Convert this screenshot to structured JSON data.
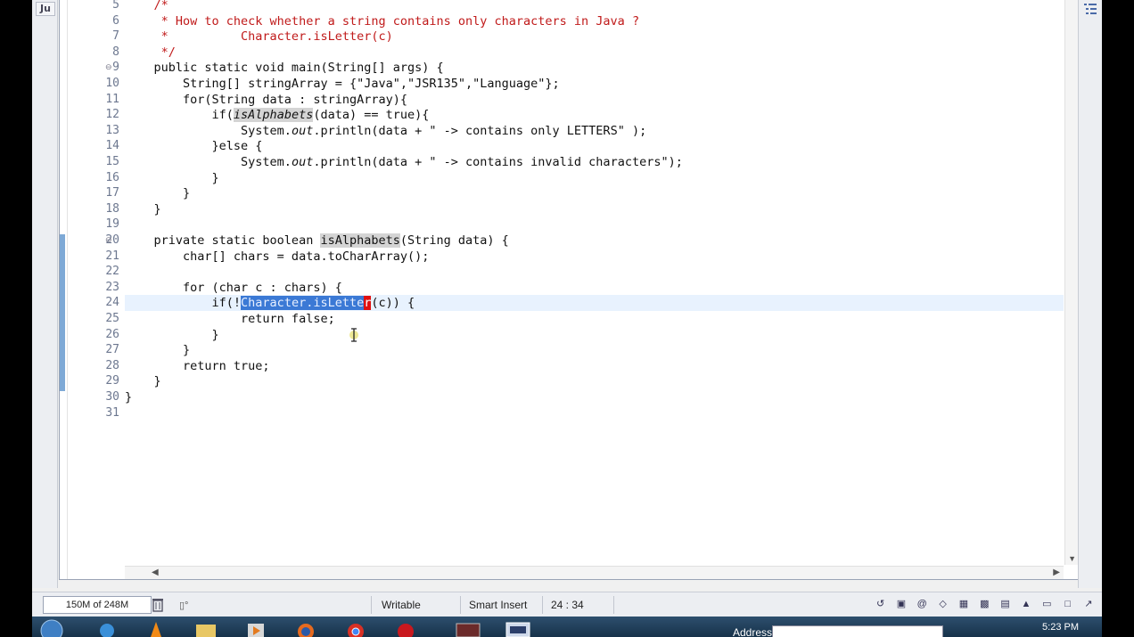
{
  "left_tab": {
    "label": "Ju"
  },
  "code_lines": [
    {
      "num": "5",
      "fold": "",
      "current": false,
      "tokens": [
        {
          "t": "    /*",
          "c": "com"
        }
      ]
    },
    {
      "num": "6",
      "fold": "",
      "current": false,
      "tokens": [
        {
          "t": "     * How to check whether a string contains only characters in Java ?",
          "c": "com"
        }
      ]
    },
    {
      "num": "7",
      "fold": "",
      "current": false,
      "tokens": [
        {
          "t": "     *          Character.isLetter(c)",
          "c": "com"
        }
      ]
    },
    {
      "num": "8",
      "fold": "",
      "current": false,
      "tokens": [
        {
          "t": "     */",
          "c": "com"
        }
      ]
    },
    {
      "num": "9",
      "fold": "⊖",
      "current": false,
      "tokens": [
        {
          "t": "    public static void main(String[] args) {",
          "c": ""
        }
      ]
    },
    {
      "num": "10",
      "fold": "",
      "current": false,
      "tokens": [
        {
          "t": "        String[] stringArray = {\"Java\",\"JSR135\",\"Language\"};",
          "c": ""
        }
      ]
    },
    {
      "num": "11",
      "fold": "",
      "current": false,
      "tokens": [
        {
          "t": "        for(String data : stringArray){",
          "c": ""
        }
      ]
    },
    {
      "num": "12",
      "fold": "",
      "current": false,
      "tokens": [
        {
          "t": "            if(",
          "c": ""
        },
        {
          "t": "isAlphabets",
          "c": "it occ"
        },
        {
          "t": "(data) == true){",
          "c": ""
        }
      ]
    },
    {
      "num": "13",
      "fold": "",
      "current": false,
      "tokens": [
        {
          "t": "                System.",
          "c": ""
        },
        {
          "t": "out",
          "c": "it"
        },
        {
          "t": ".println(data + \" -> contains only LETTERS\" );",
          "c": ""
        }
      ]
    },
    {
      "num": "14",
      "fold": "",
      "current": false,
      "tokens": [
        {
          "t": "            }else {",
          "c": ""
        }
      ]
    },
    {
      "num": "15",
      "fold": "",
      "current": false,
      "tokens": [
        {
          "t": "                System.",
          "c": ""
        },
        {
          "t": "out",
          "c": "it"
        },
        {
          "t": ".println(data + \" -> contains invalid characters\");",
          "c": ""
        }
      ]
    },
    {
      "num": "16",
      "fold": "",
      "current": false,
      "tokens": [
        {
          "t": "            }",
          "c": ""
        }
      ]
    },
    {
      "num": "17",
      "fold": "",
      "current": false,
      "tokens": [
        {
          "t": "        }",
          "c": ""
        }
      ]
    },
    {
      "num": "18",
      "fold": "",
      "current": false,
      "tokens": [
        {
          "t": "    }",
          "c": ""
        }
      ]
    },
    {
      "num": "19",
      "fold": "",
      "current": false,
      "tokens": [
        {
          "t": "",
          "c": ""
        }
      ]
    },
    {
      "num": "20",
      "fold": "⊖",
      "current": false,
      "tokens": [
        {
          "t": "    private static boolean ",
          "c": ""
        },
        {
          "t": "isAlphabets",
          "c": "occ"
        },
        {
          "t": "(String data) {",
          "c": ""
        }
      ]
    },
    {
      "num": "21",
      "fold": "",
      "current": false,
      "tokens": [
        {
          "t": "        char[] chars = data.toCharArray();",
          "c": ""
        }
      ]
    },
    {
      "num": "22",
      "fold": "",
      "current": false,
      "tokens": [
        {
          "t": "",
          "c": ""
        }
      ]
    },
    {
      "num": "23",
      "fold": "",
      "current": false,
      "tokens": [
        {
          "t": "        for (char c : chars) {",
          "c": ""
        }
      ]
    },
    {
      "num": "24",
      "fold": "",
      "current": true,
      "tokens": [
        {
          "t": "            if(!",
          "c": ""
        },
        {
          "t": "Character.isLette",
          "c": "sel"
        },
        {
          "t": "r",
          "c": "caret"
        },
        {
          "t": "(c)) {",
          "c": ""
        }
      ]
    },
    {
      "num": "25",
      "fold": "",
      "current": false,
      "tokens": [
        {
          "t": "                return false;",
          "c": ""
        }
      ]
    },
    {
      "num": "26",
      "fold": "",
      "current": false,
      "tokens": [
        {
          "t": "            }",
          "c": ""
        }
      ]
    },
    {
      "num": "27",
      "fold": "",
      "current": false,
      "tokens": [
        {
          "t": "        }",
          "c": ""
        }
      ]
    },
    {
      "num": "28",
      "fold": "",
      "current": false,
      "tokens": [
        {
          "t": "        return true;",
          "c": ""
        }
      ]
    },
    {
      "num": "29",
      "fold": "",
      "current": false,
      "tokens": [
        {
          "t": "    }",
          "c": ""
        }
      ]
    },
    {
      "num": "30",
      "fold": "",
      "current": false,
      "tokens": [
        {
          "t": "}",
          "c": ""
        }
      ]
    },
    {
      "num": "31",
      "fold": "",
      "current": false,
      "tokens": [
        {
          "t": "",
          "c": ""
        }
      ]
    }
  ],
  "status": {
    "heap": "150M of 248M",
    "mode": "Writable",
    "insert": "Smart Insert",
    "position": "24 : 34"
  },
  "taskbar": {
    "address_label": "Address",
    "clock": "5:23 PM"
  },
  "colors": {
    "comment": "#c01a1a",
    "selection": "#3b79d5",
    "current_line": "#e8f2fe"
  }
}
